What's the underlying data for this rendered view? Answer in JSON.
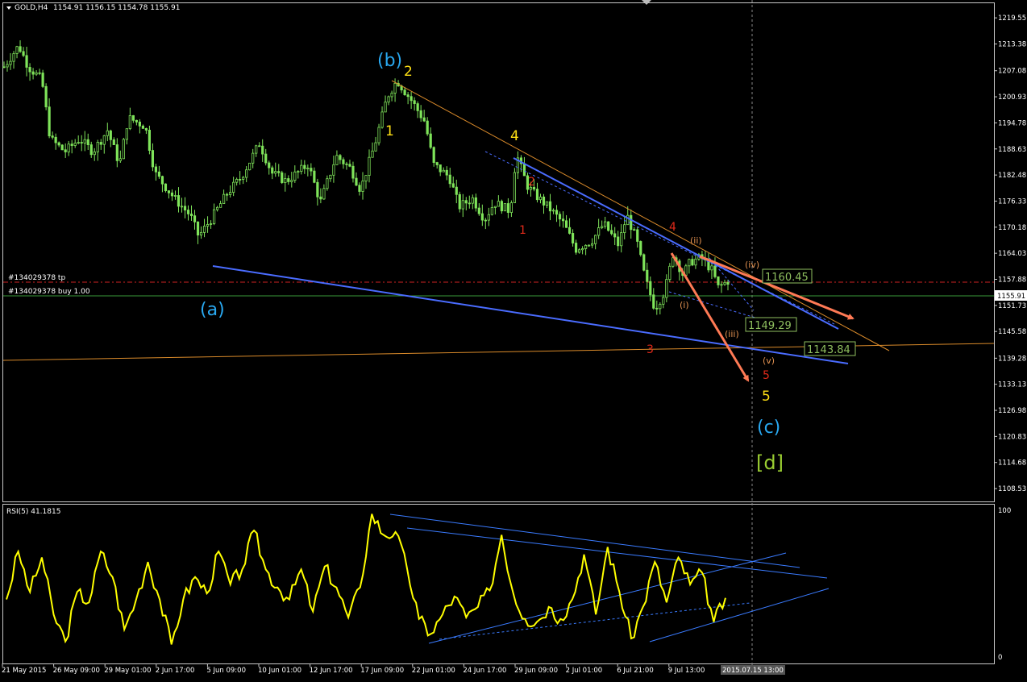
{
  "header": {
    "symbol": "GOLD,H4",
    "ohlc": "1154.91 1156.15 1154.78 1155.91"
  },
  "order_labels": {
    "tp": "#134029378 tp",
    "buy": "#134029378 buy 1.00"
  },
  "price_boxes": {
    "tp": "1160.45",
    "current": "1155.91",
    "level_1": "1149.29",
    "level_2": "1143.84"
  },
  "rsi": {
    "label": "RSI(5) 41.1815",
    "scale_top": "100",
    "scale_bottom": "0"
  },
  "time_cursor_label": "2015.07.15 13:00",
  "colors": {
    "candle": "#7fe45a",
    "rsi_line": "#ffff00",
    "trendline": "#4a6cff",
    "rsi_trendline": "#3a7bff",
    "orange_line": "#d98a2a",
    "arrow": "#ff7a55",
    "tp_line": "#cc2222",
    "wave_cyan": "#29a8f0",
    "wave_yellow": "#ffe014",
    "wave_red": "#e02a1a",
    "wave_orange": "#e09050",
    "wave_d": "#9acd32",
    "box": "#8fbf5f"
  },
  "waves": {
    "a": "(a)",
    "b": "(b)",
    "c": "(c)",
    "d": "[d]",
    "y1": "1",
    "y2": "2",
    "y4": "4",
    "y5": "5",
    "r1": "1",
    "r2": "2",
    "r3": "3",
    "r4": "4",
    "r5": "5",
    "ri": "(i)",
    "rii": "(ii)",
    "riii": "(iii)",
    "riv": "(iv)",
    "rv": "(v)"
  },
  "chart_data": {
    "type": "candlestick",
    "title": "GOLD,H4",
    "y_ticks": [
      "1219.55",
      "1213.38",
      "1207.08",
      "1200.93",
      "1194.78",
      "1188.63",
      "1182.48",
      "1176.33",
      "1170.18",
      "1164.03",
      "1157.88",
      "1151.73",
      "1145.58",
      "1139.28",
      "1133.13",
      "1126.98",
      "1120.83",
      "1114.68",
      "1108.53"
    ],
    "x_ticks": [
      "21 May 2015",
      "26 May 09:00",
      "29 May 01:00",
      "2 Jun 17:00",
      "5 Jun 09:00",
      "10 Jun 01:00",
      "12 Jun 17:00",
      "17 Jun 09:00",
      "22 Jun 01:00",
      "24 Jun 17:00",
      "29 Jun 09:00",
      "2 Jul 01:00",
      "6 Jul 21:00",
      "9 Jul 13:00"
    ],
    "ylim": [
      1105.5,
      1223
    ],
    "price_path": [
      {
        "x": 0,
        "y": 1208
      },
      {
        "x": 1.2,
        "y": 1213
      },
      {
        "x": 2,
        "y": 1208
      },
      {
        "x": 3.1,
        "y": 1205
      },
      {
        "x": 3.8,
        "y": 1191
      },
      {
        "x": 5,
        "y": 1188
      },
      {
        "x": 6.2,
        "y": 1191
      },
      {
        "x": 7.3,
        "y": 1188
      },
      {
        "x": 8.5,
        "y": 1193
      },
      {
        "x": 9.5,
        "y": 1185
      },
      {
        "x": 10.2,
        "y": 1196
      },
      {
        "x": 11.6,
        "y": 1194
      },
      {
        "x": 12.4,
        "y": 1183
      },
      {
        "x": 14,
        "y": 1177
      },
      {
        "x": 15.3,
        "y": 1173
      },
      {
        "x": 16,
        "y": 1168
      },
      {
        "x": 17,
        "y": 1172
      },
      {
        "x": 18.3,
        "y": 1178
      },
      {
        "x": 19.5,
        "y": 1182
      },
      {
        "x": 21,
        "y": 1190
      },
      {
        "x": 22,
        "y": 1183
      },
      {
        "x": 23.2,
        "y": 1181
      },
      {
        "x": 25,
        "y": 1185
      },
      {
        "x": 26,
        "y": 1176
      },
      {
        "x": 27.3,
        "y": 1187
      },
      {
        "x": 28.5,
        "y": 1184
      },
      {
        "x": 29.3,
        "y": 1179
      },
      {
        "x": 30.5,
        "y": 1190
      },
      {
        "x": 31.5,
        "y": 1201
      },
      {
        "x": 32.3,
        "y": 1204.8
      },
      {
        "x": 33.5,
        "y": 1200
      },
      {
        "x": 34.6,
        "y": 1195
      },
      {
        "x": 35.3,
        "y": 1185
      },
      {
        "x": 36.6,
        "y": 1182
      },
      {
        "x": 37.4,
        "y": 1175
      },
      {
        "x": 38.5,
        "y": 1177
      },
      {
        "x": 39.5,
        "y": 1172
      },
      {
        "x": 40.3,
        "y": 1176
      },
      {
        "x": 41.6,
        "y": 1174
      },
      {
        "x": 42.1,
        "y": 1187.5
      },
      {
        "x": 43,
        "y": 1180
      },
      {
        "x": 43.6,
        "y": 1178
      },
      {
        "x": 44.7,
        "y": 1175
      },
      {
        "x": 46,
        "y": 1171
      },
      {
        "x": 47,
        "y": 1165
      },
      {
        "x": 48.3,
        "y": 1167
      },
      {
        "x": 49.3,
        "y": 1171
      },
      {
        "x": 50.5,
        "y": 1166
      },
      {
        "x": 51.2,
        "y": 1173
      },
      {
        "x": 52,
        "y": 1167
      },
      {
        "x": 52.7,
        "y": 1158
      },
      {
        "x": 53.5,
        "y": 1151
      },
      {
        "x": 54.3,
        "y": 1155
      },
      {
        "x": 55,
        "y": 1164
      },
      {
        "x": 55.8,
        "y": 1159
      },
      {
        "x": 56.4,
        "y": 1162
      },
      {
        "x": 57.3,
        "y": 1163
      },
      {
        "x": 58.2,
        "y": 1160
      },
      {
        "x": 58.7,
        "y": 1156
      },
      {
        "x": 59.5,
        "y": 1157.5
      }
    ],
    "rsi_path": [
      {
        "x": 0,
        "y": 40
      },
      {
        "x": 1,
        "y": 72
      },
      {
        "x": 2,
        "y": 45
      },
      {
        "x": 3,
        "y": 68
      },
      {
        "x": 4,
        "y": 30
      },
      {
        "x": 5,
        "y": 12
      },
      {
        "x": 6,
        "y": 45
      },
      {
        "x": 7,
        "y": 38
      },
      {
        "x": 8,
        "y": 72
      },
      {
        "x": 9,
        "y": 55
      },
      {
        "x": 10,
        "y": 20
      },
      {
        "x": 11,
        "y": 40
      },
      {
        "x": 12,
        "y": 65
      },
      {
        "x": 13,
        "y": 40
      },
      {
        "x": 14,
        "y": 10
      },
      {
        "x": 15,
        "y": 40
      },
      {
        "x": 16,
        "y": 55
      },
      {
        "x": 17,
        "y": 44
      },
      {
        "x": 18,
        "y": 72
      },
      {
        "x": 19,
        "y": 50
      },
      {
        "x": 20,
        "y": 60
      },
      {
        "x": 21,
        "y": 86
      },
      {
        "x": 22,
        "y": 60
      },
      {
        "x": 23,
        "y": 48
      },
      {
        "x": 24,
        "y": 40
      },
      {
        "x": 25,
        "y": 60
      },
      {
        "x": 26,
        "y": 32
      },
      {
        "x": 27,
        "y": 62
      },
      {
        "x": 28,
        "y": 48
      },
      {
        "x": 29,
        "y": 28
      },
      {
        "x": 30,
        "y": 48
      },
      {
        "x": 31,
        "y": 97
      },
      {
        "x": 32,
        "y": 83
      },
      {
        "x": 33,
        "y": 85
      },
      {
        "x": 34,
        "y": 60
      },
      {
        "x": 35,
        "y": 27
      },
      {
        "x": 36,
        "y": 17
      },
      {
        "x": 37,
        "y": 30
      },
      {
        "x": 38,
        "y": 42
      },
      {
        "x": 39,
        "y": 28
      },
      {
        "x": 40,
        "y": 35
      },
      {
        "x": 41,
        "y": 46
      },
      {
        "x": 42,
        "y": 83
      },
      {
        "x": 43,
        "y": 44
      },
      {
        "x": 44,
        "y": 27
      },
      {
        "x": 45,
        "y": 25
      },
      {
        "x": 46,
        "y": 35
      },
      {
        "x": 47,
        "y": 27
      },
      {
        "x": 48,
        "y": 40
      },
      {
        "x": 49,
        "y": 70
      },
      {
        "x": 50,
        "y": 30
      },
      {
        "x": 51,
        "y": 75
      },
      {
        "x": 52,
        "y": 45
      },
      {
        "x": 53,
        "y": 14
      },
      {
        "x": 54,
        "y": 35
      },
      {
        "x": 55,
        "y": 65
      },
      {
        "x": 56,
        "y": 38
      },
      {
        "x": 57,
        "y": 68
      },
      {
        "x": 58,
        "y": 50
      },
      {
        "x": 59,
        "y": 58
      },
      {
        "x": 60,
        "y": 25
      },
      {
        "x": 61,
        "y": 41
      }
    ],
    "rsi_ylim": [
      0,
      100
    ],
    "levels": {
      "tp": 1160.45,
      "current": 1155.91
    }
  }
}
